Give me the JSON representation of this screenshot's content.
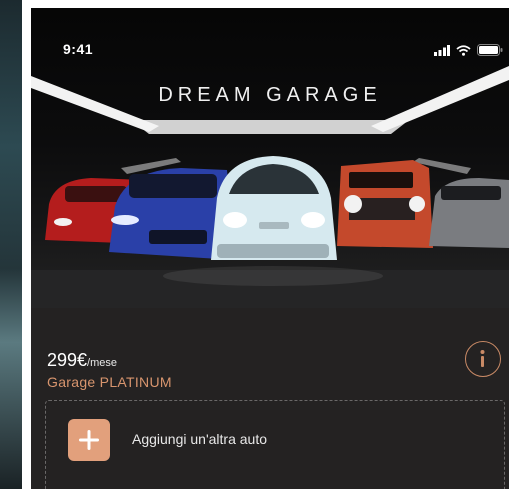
{
  "status_bar": {
    "time": "9:41"
  },
  "brand": {
    "logo_text": "DREAM GARAGE"
  },
  "plan": {
    "price": "299€",
    "price_unit": "/mese",
    "name": "Garage PLATINUM"
  },
  "actions": {
    "add_car_label": "Aggiungi un'altra auto"
  },
  "colors": {
    "background": "#242222",
    "accent": "#d8956e",
    "add_button": "#e2a07c"
  },
  "icons": [
    "signal-icon",
    "wifi-icon",
    "battery-icon",
    "info-icon",
    "plus-icon"
  ]
}
